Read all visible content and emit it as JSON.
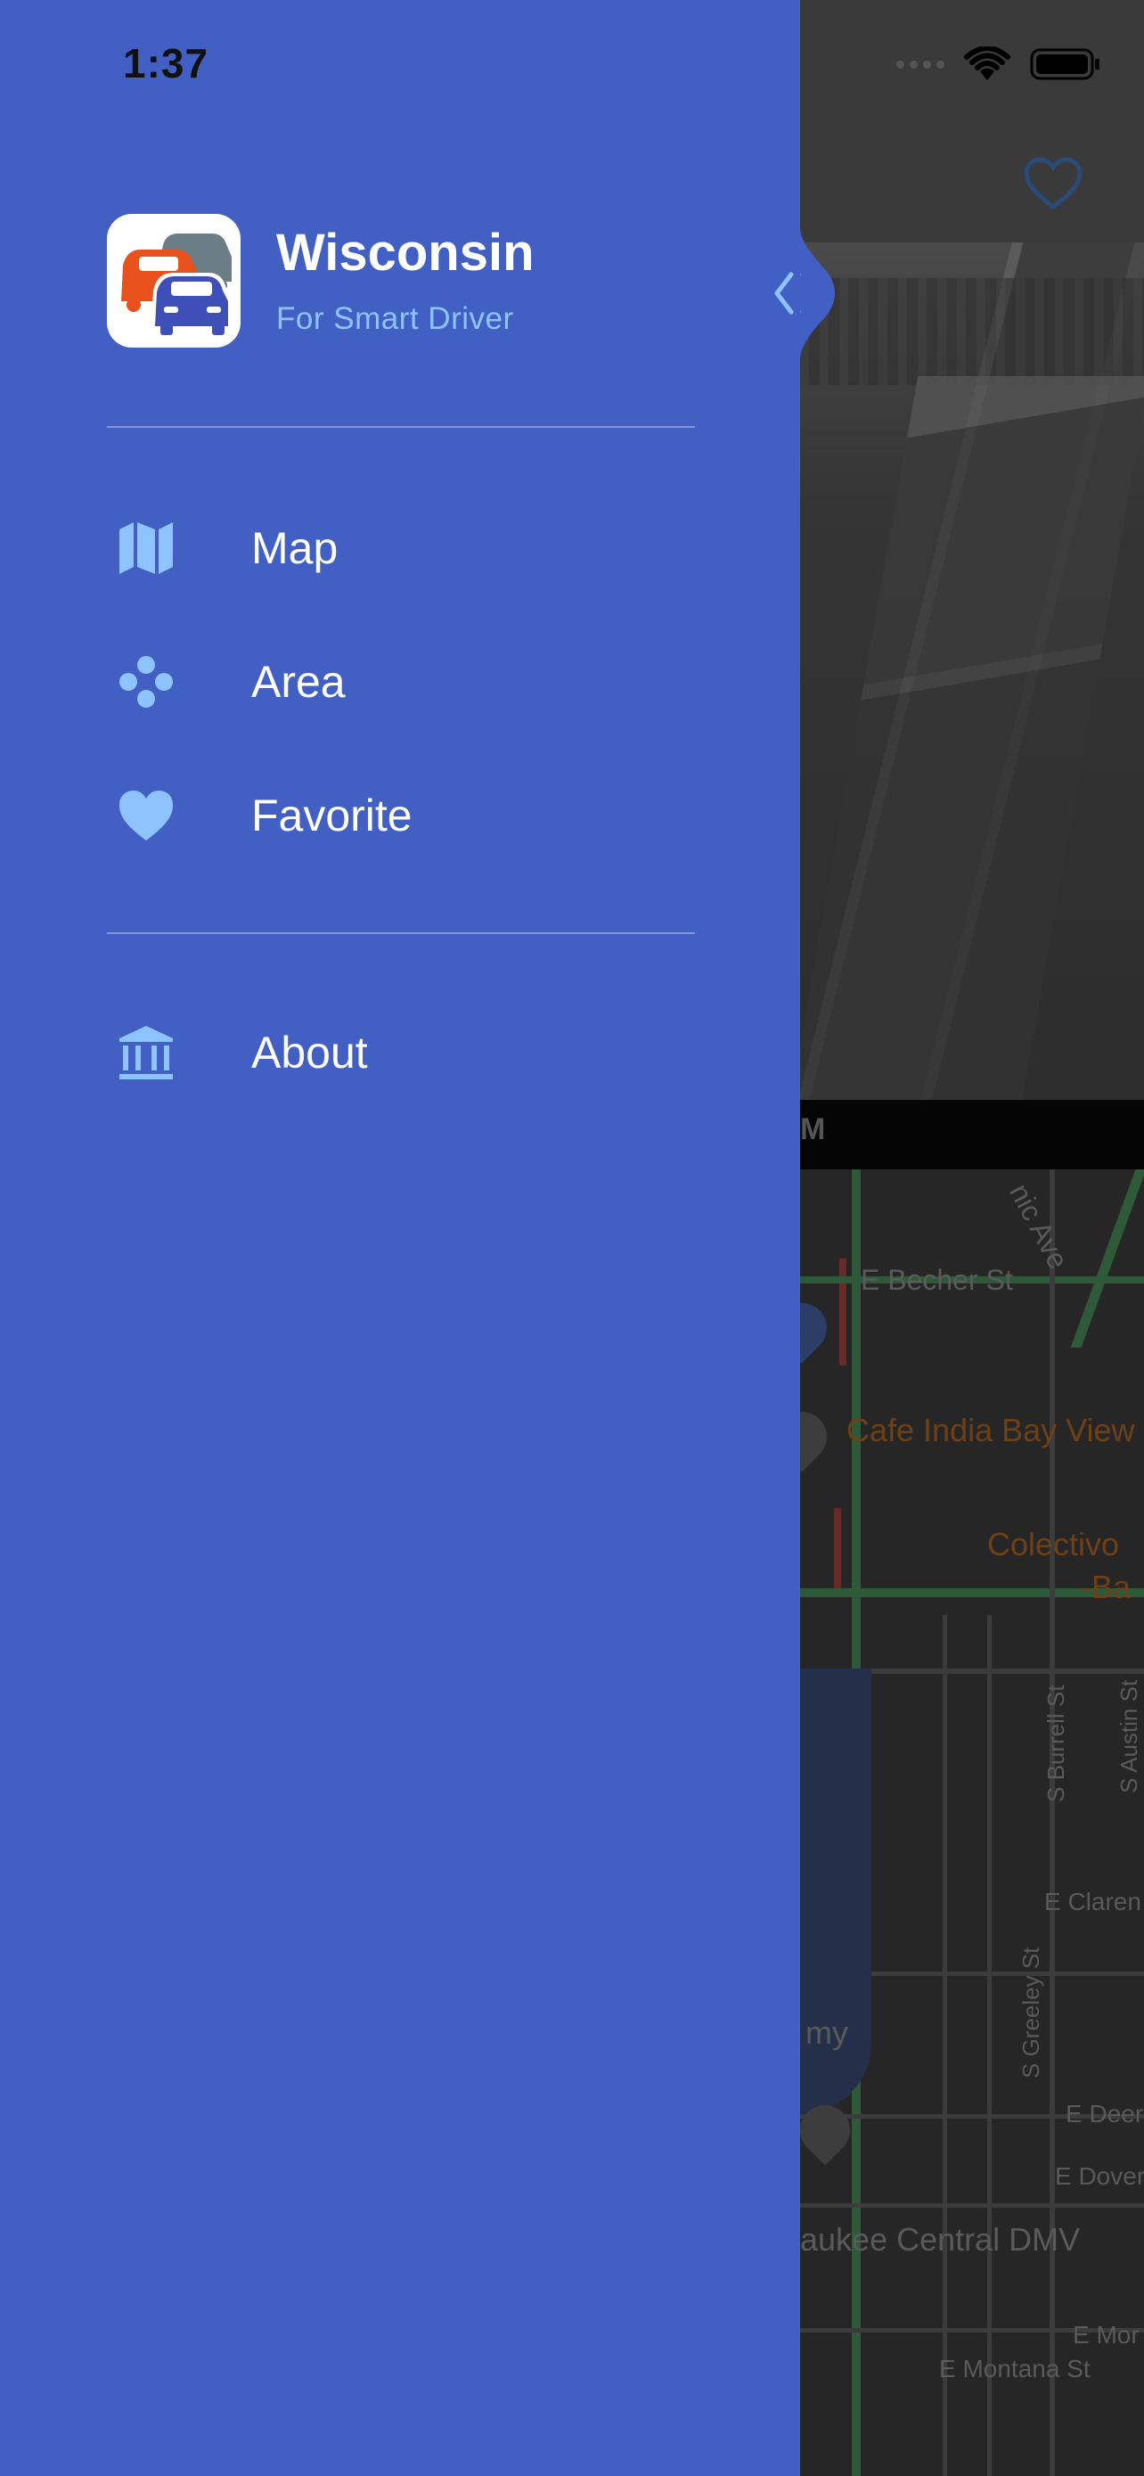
{
  "status_bar": {
    "time": "1:37"
  },
  "drawer": {
    "app_name": "Wisconsin",
    "tagline": "For Smart Driver",
    "menu": [
      {
        "label": "Map",
        "icon": "map-icon"
      },
      {
        "label": "Area",
        "icon": "area-dots-icon"
      },
      {
        "label": "Favorite",
        "icon": "heart-icon"
      }
    ],
    "secondary_menu": [
      {
        "label": "About",
        "icon": "bank-icon"
      }
    ]
  },
  "background": {
    "camera_time_fragment": "M",
    "map_labels": {
      "ave": "nic Ave",
      "becher": "E Becher St",
      "cafe": "Cafe India Bay View",
      "colectivo": "Colectivo",
      "colectivo_sub": "-Ba",
      "burrell": "S Burrell St",
      "austin": "S Austin St",
      "claren": "E Claren",
      "greeley": "S Greeley St",
      "my": "my",
      "deer": "E Deer",
      "dover": "E Dover",
      "dmv": "aukee Central DMV",
      "mor": "E Mor",
      "montana": "E Montana St"
    }
  },
  "colors": {
    "drawer_bg": "#425FC4",
    "accent_light_blue": "#8DC4FF",
    "logo_orange": "#E8501C",
    "logo_gray": "#6B7E86",
    "logo_blue": "#3F4FB8"
  }
}
